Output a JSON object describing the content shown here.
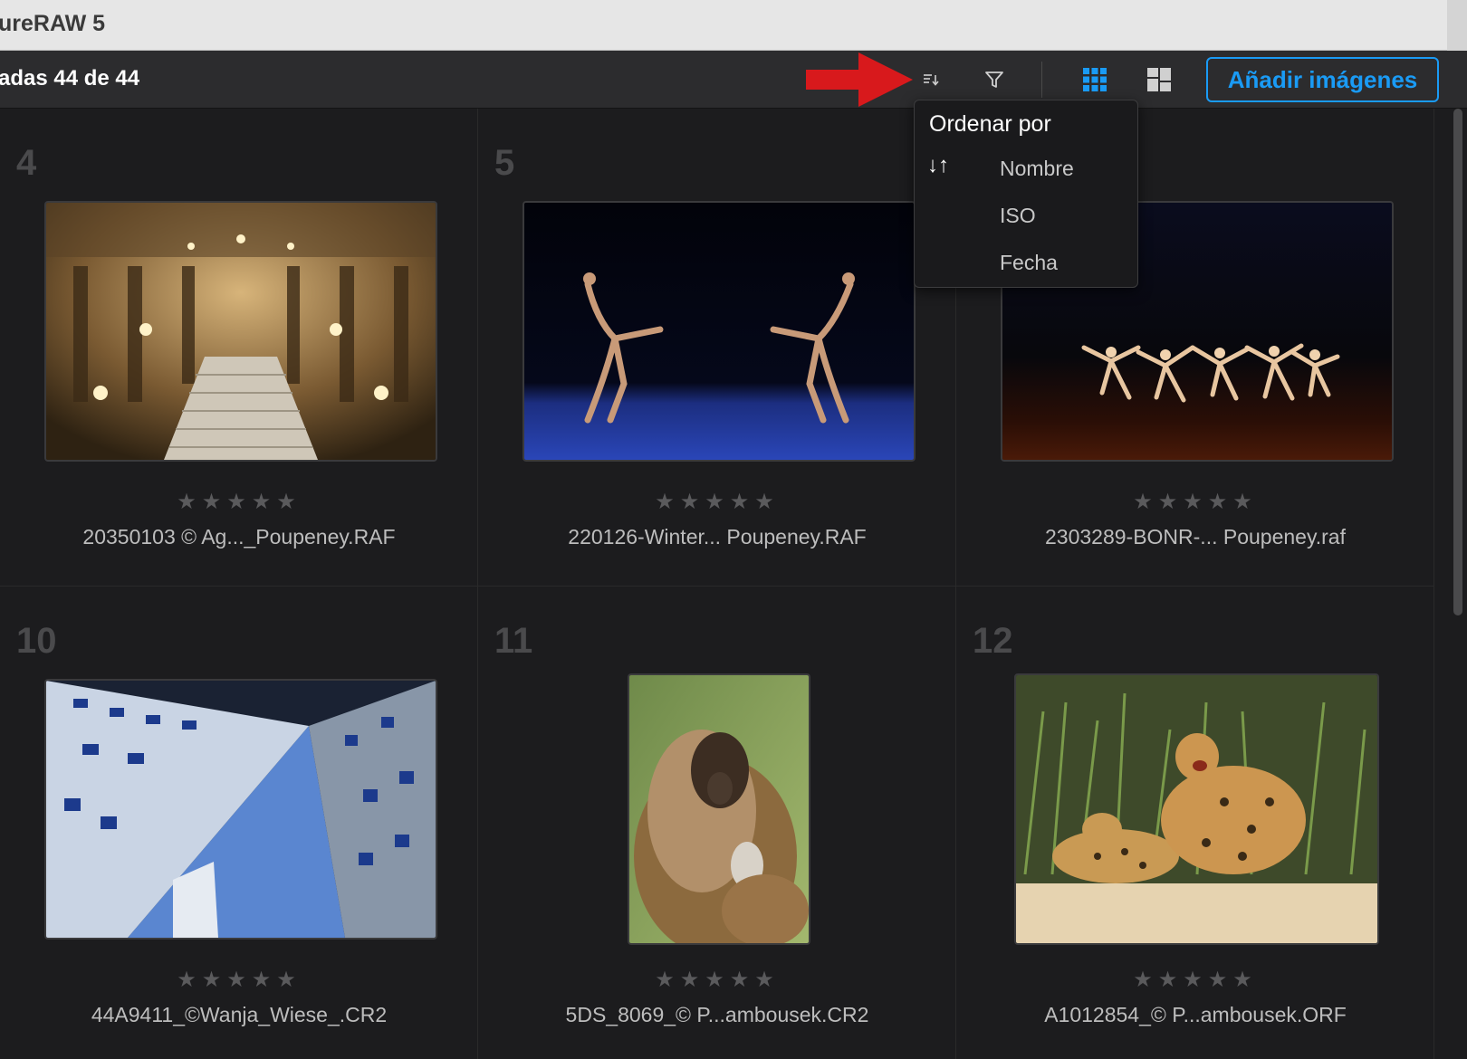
{
  "window": {
    "title": "ureRAW 5"
  },
  "toolbar": {
    "count_label": "adas 44 de 44",
    "sort_icon": "sort-icon",
    "filter_icon": "filter-icon",
    "grid_icon": "grid-view-icon",
    "mosaic_icon": "mosaic-view-icon",
    "add_button": "Añadir imágenes",
    "accent_color": "#1a9bf5"
  },
  "sort_menu": {
    "title": "Ordenar por",
    "direction_icon": "↓↑",
    "options": [
      "Nombre",
      "ISO",
      "Fecha"
    ]
  },
  "images": [
    {
      "index": "4",
      "filename": "20350103 © Ag..._Poupeney.RAF",
      "stars": "★★★★★",
      "rating": 0
    },
    {
      "index": "5",
      "filename": "220126-Winter... Poupeney.RAF",
      "stars": "★★★★★",
      "rating": 0
    },
    {
      "index": "",
      "filename": "2303289-BONR-... Poupeney.raf",
      "stars": "★★★★★",
      "rating": 0
    },
    {
      "index": "10",
      "filename": "44A9411_©Wanja_Wiese_.CR2",
      "stars": "★★★★★",
      "rating": 0
    },
    {
      "index": "11",
      "filename": "5DS_8069_© P...ambousek.CR2",
      "stars": "★★★★★",
      "rating": 0
    },
    {
      "index": "12",
      "filename": "A1012854_© P...ambousek.ORF",
      "stars": "★★★★★",
      "rating": 0
    }
  ]
}
